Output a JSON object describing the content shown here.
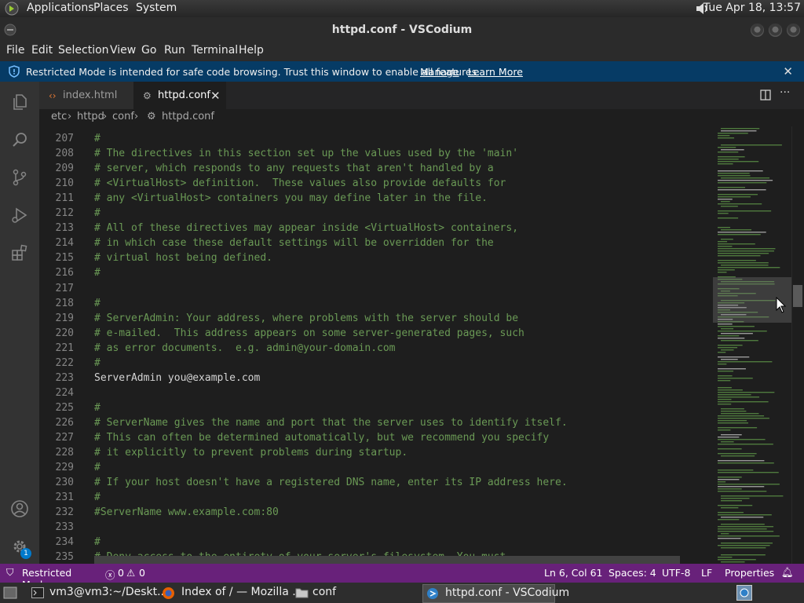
{
  "top_panel": {
    "menus": [
      "Applications",
      "Places",
      "System"
    ],
    "clock": "Tue Apr 18, 13:57"
  },
  "window": {
    "title": "httpd.conf - VSCodium"
  },
  "menubar": {
    "items": [
      "File",
      "Edit",
      "Selection",
      "View",
      "Go",
      "Run",
      "Terminal",
      "Help"
    ]
  },
  "banner": {
    "message": "Restricted Mode is intended for safe code browsing. Trust this window to enable all features.",
    "manage": "Manage",
    "learn_more": "Learn More"
  },
  "tabs": [
    {
      "label": "index.html",
      "icon": "html-brackets-icon",
      "active": false
    },
    {
      "label": "httpd.conf",
      "icon": "gear-icon",
      "active": true
    }
  ],
  "breadcrumbs": [
    "etc",
    "httpd",
    "conf",
    "httpd.conf"
  ],
  "editor": {
    "lines": [
      {
        "n": "207",
        "text": "#",
        "type": "comment"
      },
      {
        "n": "208",
        "text": "# The directives in this section set up the values used by the 'main'",
        "type": "comment"
      },
      {
        "n": "209",
        "text": "# server, which responds to any requests that aren't handled by a",
        "type": "comment"
      },
      {
        "n": "210",
        "text": "# <VirtualHost> definition.  These values also provide defaults for",
        "type": "comment"
      },
      {
        "n": "211",
        "text": "# any <VirtualHost> containers you may define later in the file.",
        "type": "comment"
      },
      {
        "n": "212",
        "text": "#",
        "type": "comment"
      },
      {
        "n": "213",
        "text": "# All of these directives may appear inside <VirtualHost> containers,",
        "type": "comment"
      },
      {
        "n": "214",
        "text": "# in which case these default settings will be overridden for the",
        "type": "comment"
      },
      {
        "n": "215",
        "text": "# virtual host being defined.",
        "type": "comment"
      },
      {
        "n": "216",
        "text": "#",
        "type": "comment"
      },
      {
        "n": "217",
        "text": "",
        "type": "plain"
      },
      {
        "n": "218",
        "text": "#",
        "type": "comment"
      },
      {
        "n": "219",
        "text": "# ServerAdmin: Your address, where problems with the server should be",
        "type": "comment"
      },
      {
        "n": "220",
        "text": "# e-mailed.  This address appears on some server-generated pages, such",
        "type": "comment"
      },
      {
        "n": "221",
        "text": "# as error documents.  e.g. admin@your-domain.com",
        "type": "comment"
      },
      {
        "n": "222",
        "text": "#",
        "type": "comment"
      },
      {
        "n": "223",
        "text": "ServerAdmin you@example.com",
        "type": "plain"
      },
      {
        "n": "224",
        "text": "",
        "type": "plain"
      },
      {
        "n": "225",
        "text": "#",
        "type": "comment"
      },
      {
        "n": "226",
        "text": "# ServerName gives the name and port that the server uses to identify itself.",
        "type": "comment"
      },
      {
        "n": "227",
        "text": "# This can often be determined automatically, but we recommend you specify",
        "type": "comment"
      },
      {
        "n": "228",
        "text": "# it explicitly to prevent problems during startup.",
        "type": "comment"
      },
      {
        "n": "229",
        "text": "#",
        "type": "comment"
      },
      {
        "n": "230",
        "text": "# If your host doesn't have a registered DNS name, enter its IP address here.",
        "type": "comment"
      },
      {
        "n": "231",
        "text": "#",
        "type": "comment"
      },
      {
        "n": "232",
        "text": "#ServerName www.example.com:80",
        "type": "comment"
      },
      {
        "n": "233",
        "text": "",
        "type": "plain"
      },
      {
        "n": "234",
        "text": "#",
        "type": "comment"
      },
      {
        "n": "235",
        "text": "# Deny access to the entirety of your server's filesystem. You must",
        "type": "comment"
      }
    ]
  },
  "statusbar": {
    "restricted": "Restricted Mode",
    "errors": "0",
    "warnings": "0",
    "position": "Ln 6, Col 61",
    "spaces": "Spaces: 4",
    "encoding": "UTF-8",
    "eol": "LF",
    "language": "Properties"
  },
  "activity": {
    "settings_badge": "1"
  },
  "taskbar": [
    {
      "label": "vm3@vm3:~/Deskt..."
    },
    {
      "label": "Index of / — Mozilla ..."
    },
    {
      "label": "conf"
    },
    {
      "label": "httpd.conf - VSCodium"
    }
  ],
  "colors": {
    "accent_status": "#68217a",
    "banner": "#063b65",
    "comment": "#6a9955"
  }
}
